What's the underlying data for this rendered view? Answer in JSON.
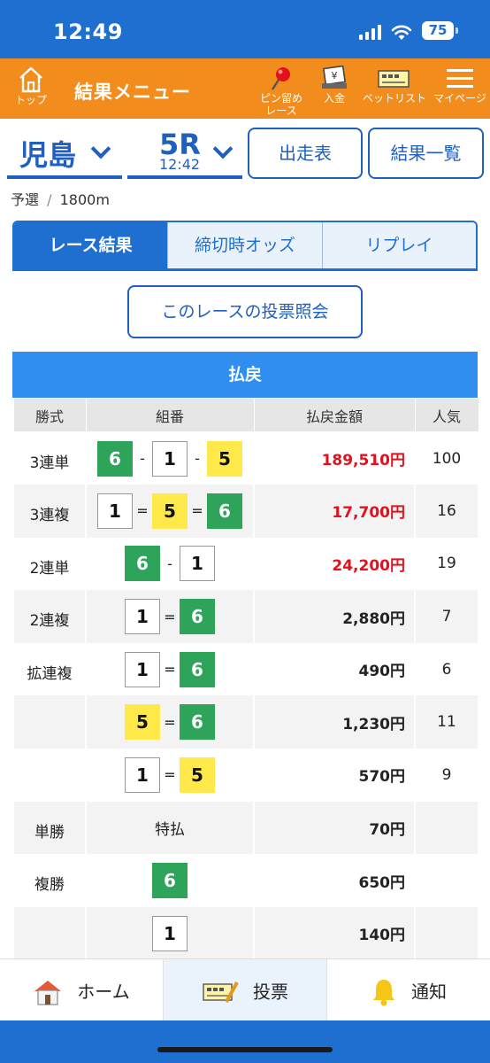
{
  "status": {
    "time": "12:49",
    "battery": "75"
  },
  "header": {
    "home_label": "トップ",
    "title": "結果メニュー",
    "pin_label_1": "ピン留め",
    "pin_label_2": "レース",
    "deposit_label": "入金",
    "betlist_label": "ベットリスト",
    "mypage_label": "マイページ"
  },
  "race": {
    "venue": "児島",
    "number": "5R",
    "time": "12:42",
    "entry_button": "出走表",
    "results_button": "結果一覧",
    "category": "予選",
    "distance": "1800m",
    "divider": "/"
  },
  "tabs": [
    {
      "label": "レース結果",
      "active": true
    },
    {
      "label": "締切時オッズ",
      "active": false
    },
    {
      "label": "リプレイ",
      "active": false
    }
  ],
  "query_button": "このレースの投票照会",
  "payout": {
    "title": "払戻",
    "headers": [
      "勝式",
      "組番",
      "払戻金額",
      "人気"
    ],
    "rows": [
      {
        "type": "3連単",
        "boats": [
          "6",
          "1",
          "5"
        ],
        "sep": "-",
        "amount": "189,510円",
        "pop": "100",
        "red": true
      },
      {
        "type": "3連複",
        "boats": [
          "1",
          "5",
          "6"
        ],
        "sep": "=",
        "amount": "17,700円",
        "pop": "16",
        "red": true
      },
      {
        "type": "2連単",
        "boats": [
          "6",
          "1"
        ],
        "sep": "-",
        "amount": "24,200円",
        "pop": "19",
        "red": true
      },
      {
        "type": "2連複",
        "boats": [
          "1",
          "6"
        ],
        "sep": "=",
        "amount": "2,880円",
        "pop": "7",
        "red": false
      },
      {
        "type": "拡連複",
        "boats": [
          "1",
          "6"
        ],
        "sep": "=",
        "amount": "490円",
        "pop": "6",
        "red": false
      },
      {
        "type": "",
        "boats": [
          "5",
          "6"
        ],
        "sep": "=",
        "amount": "1,230円",
        "pop": "11",
        "red": false
      },
      {
        "type": "",
        "boats": [
          "1",
          "5"
        ],
        "sep": "=",
        "amount": "570円",
        "pop": "9",
        "red": false
      },
      {
        "type": "単勝",
        "combo_text": "特払",
        "boats": [],
        "sep": "",
        "amount": "70円",
        "pop": "",
        "red": false
      },
      {
        "type": "複勝",
        "boats": [
          "6"
        ],
        "sep": "",
        "amount": "650円",
        "pop": "",
        "red": false
      },
      {
        "type": "",
        "boats": [
          "1"
        ],
        "sep": "",
        "amount": "140円",
        "pop": "",
        "red": false
      }
    ]
  },
  "bottom_nav": {
    "home": "ホーム",
    "vote": "投票",
    "notify": "通知"
  },
  "colors": {
    "status_blue": "#1f6fd0",
    "header_orange": "#f28c1c",
    "accent_blue": "#1f5fbf",
    "table_header_blue": "#2f8ef0",
    "payout_red": "#e3101e",
    "boat_green": "#2ea35a",
    "boat_yellow": "#ffe94a"
  }
}
